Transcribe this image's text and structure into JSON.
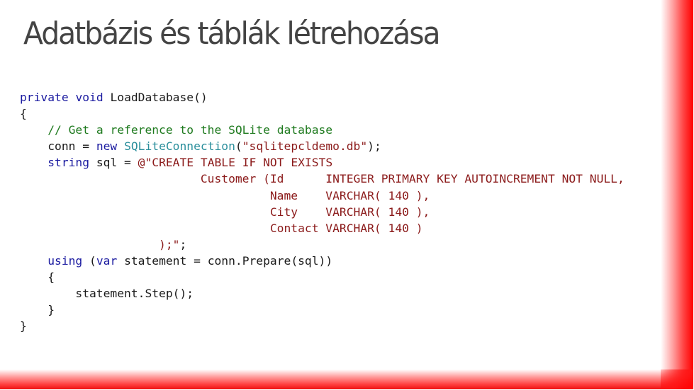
{
  "slide": {
    "title": "Adatbázis és táblák létrehozása",
    "accent_color": "#ff0000",
    "title_color": "#444444"
  },
  "code": {
    "language": "csharp",
    "colors": {
      "keyword": "#1a1aa0",
      "comment": "#1e7a1e",
      "type": "#2b8f9c",
      "string": "#8b1a1a",
      "plain": "#1a1a1a"
    },
    "lines": [
      [
        {
          "t": "kw",
          "v": "private"
        },
        {
          "t": "pl",
          "v": " "
        },
        {
          "t": "kw",
          "v": "void"
        },
        {
          "t": "pl",
          "v": " LoadDatabase()"
        }
      ],
      [
        {
          "t": "pl",
          "v": "{"
        }
      ],
      [
        {
          "t": "pl",
          "v": "    "
        },
        {
          "t": "cm",
          "v": "// Get a reference to the SQLite database"
        }
      ],
      [
        {
          "t": "pl",
          "v": "    conn = "
        },
        {
          "t": "kw",
          "v": "new"
        },
        {
          "t": "pl",
          "v": " "
        },
        {
          "t": "ty",
          "v": "SQLiteConnection"
        },
        {
          "t": "pl",
          "v": "("
        },
        {
          "t": "st",
          "v": "\"sqlitepcldemo.db\""
        },
        {
          "t": "pl",
          "v": ");"
        }
      ],
      [
        {
          "t": "pl",
          "v": "    "
        },
        {
          "t": "kw",
          "v": "string"
        },
        {
          "t": "pl",
          "v": " sql = "
        },
        {
          "t": "st",
          "v": "@\"CREATE TABLE IF NOT EXISTS"
        }
      ],
      [
        {
          "t": "st",
          "v": "                          Customer (Id      INTEGER PRIMARY KEY AUTOINCREMENT NOT NULL,"
        }
      ],
      [
        {
          "t": "st",
          "v": "                                    Name    VARCHAR( 140 ),"
        }
      ],
      [
        {
          "t": "st",
          "v": "                                    City    VARCHAR( 140 ),"
        }
      ],
      [
        {
          "t": "st",
          "v": "                                    Contact VARCHAR( 140 )"
        }
      ],
      [
        {
          "t": "st",
          "v": "                    );\""
        },
        {
          "t": "pl",
          "v": ";"
        }
      ],
      [
        {
          "t": "pl",
          "v": "    "
        },
        {
          "t": "kw",
          "v": "using"
        },
        {
          "t": "pl",
          "v": " ("
        },
        {
          "t": "kw",
          "v": "var"
        },
        {
          "t": "pl",
          "v": " statement = conn.Prepare(sql))"
        }
      ],
      [
        {
          "t": "pl",
          "v": "    {"
        }
      ],
      [
        {
          "t": "pl",
          "v": "        statement.Step();"
        }
      ],
      [
        {
          "t": "pl",
          "v": "    }"
        }
      ],
      [
        {
          "t": "pl",
          "v": "}"
        }
      ]
    ]
  }
}
